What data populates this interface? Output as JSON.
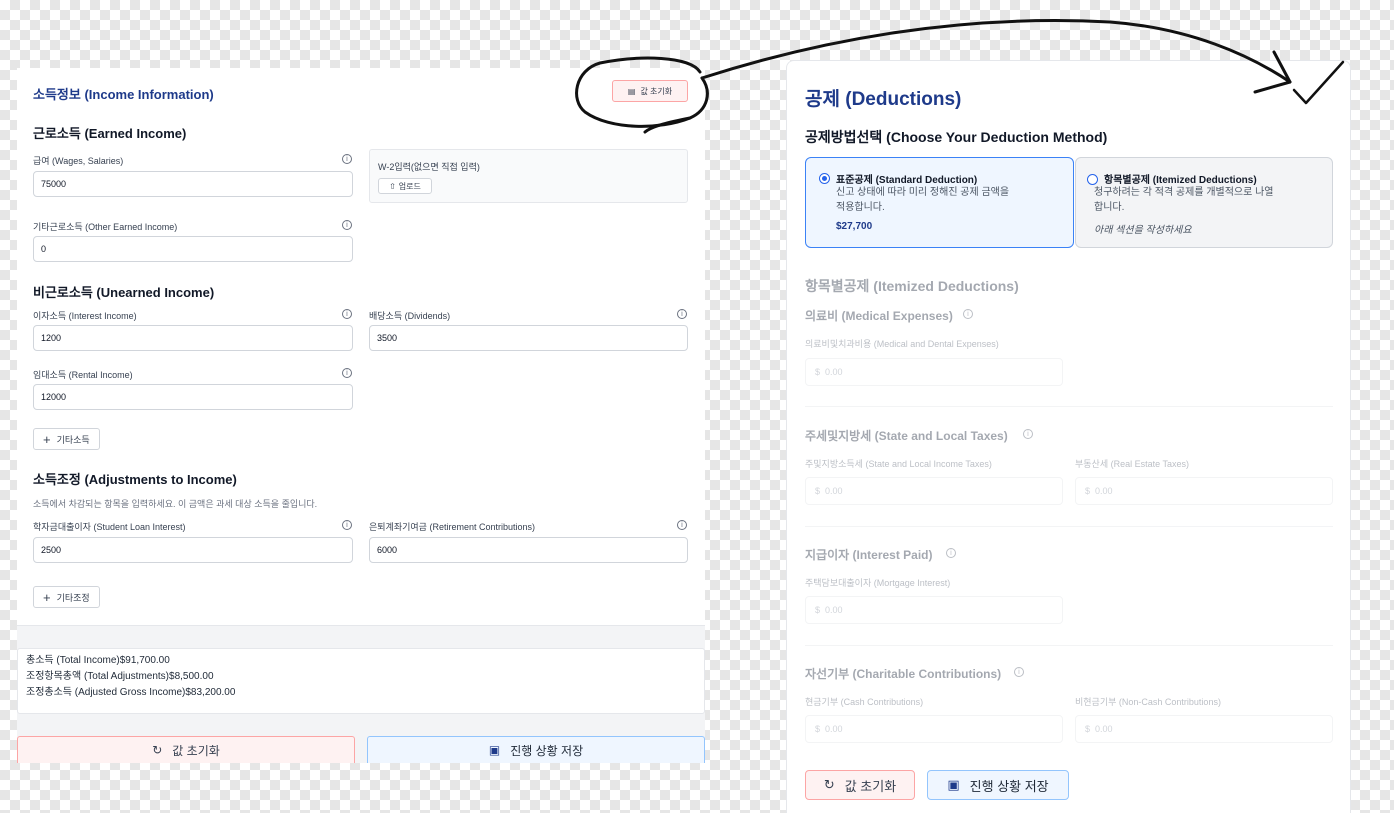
{
  "income": {
    "section_title": "소득정보 (Income Information)",
    "reset_small_label": "값 초기화",
    "earned_title": "근로소득 (Earned Income)",
    "wages_label": "급여 (Wages, Salaries)",
    "wages_value": "75000",
    "w2_label": "W-2입력(없으면 직접 입력)",
    "upload_label": "업로드",
    "other_earned_label": "기타근로소득 (Other Earned Income)",
    "other_earned_value": "0",
    "unearned_title": "비근로소득 (Unearned Income)",
    "interest_label": "이자소득 (Interest Income)",
    "interest_value": "1200",
    "dividends_label": "배당소득 (Dividends)",
    "dividends_value": "3500",
    "rental_label": "임대소득 (Rental Income)",
    "rental_value": "12000",
    "add_other_income_label": "기타소득",
    "adjustments_title": "소득조정 (Adjustments to Income)",
    "adjustments_desc": "소득에서 차감되는 항목을 입력하세요. 이 금액은 과세 대상 소득을 줄입니다.",
    "student_loan_label": "학자금대출이자 (Student Loan Interest)",
    "student_loan_value": "2500",
    "retirement_label": "은퇴계좌기여금 (Retirement Contributions)",
    "retirement_value": "6000",
    "add_other_adjust_label": "기타조정"
  },
  "summary": {
    "total_income": "총소득 (Total Income)$91,700.00",
    "total_adjustments": "조정항목총액 (Total Adjustments)$8,500.00",
    "agi": "조정총소득 (Adjusted Gross Income)$83,200.00"
  },
  "left_actions": {
    "reset_label": "값 초기화",
    "save_label": "진행 상황 저장"
  },
  "deductions": {
    "title": "공제 (Deductions)",
    "method_title": "공제방법선택 (Choose Your Deduction Method)",
    "standard": {
      "title": "표준공제 (Standard Deduction)",
      "desc_line1": "신고 상태에 따라 미리 정해진 공제 금액을",
      "desc_line2": "적용합니다.",
      "amount": "$27,700",
      "selected": true
    },
    "itemized": {
      "title": "항목별공제 (Itemized Deductions)",
      "desc_line1": "청구하려는 각 적격 공제를 개별적으로 나열",
      "desc_line2": "합니다.",
      "note": "아래 섹션을 작성하세요",
      "selected": false
    },
    "itemized_section": {
      "title": "항목별공제 (Itemized Deductions)",
      "medical_title": "의료비 (Medical Expenses)",
      "medical_label": "의료비및치과비용 (Medical and Dental Expenses)",
      "salt_title": "주세및지방세 (State and Local Taxes)",
      "state_income_label": "주및지방소득세 (State and Local Income Taxes)",
      "real_estate_label": "부동산세 (Real Estate Taxes)",
      "interest_title": "지급이자 (Interest Paid)",
      "mortgage_label": "주택담보대출이자 (Mortgage Interest)",
      "charity_title": "자선기부 (Charitable Contributions)",
      "cash_label": "현금기부 (Cash Contributions)",
      "noncash_label": "비현금기부 (Non-Cash Contributions)",
      "currency": "$",
      "placeholder": "0.00"
    },
    "reset_label": "값 초기화",
    "save_label": "진행 상황 저장"
  },
  "icons": {
    "info": "info-icon",
    "reset": "reset-icon",
    "save": "save-icon",
    "upload": "upload-icon",
    "plus": "plus-icon"
  },
  "colors": {
    "accent": "#1e3a8a",
    "reset_bg": "#fef2f2",
    "save_bg": "#eff6ff",
    "selected_border": "#3b82f6"
  }
}
